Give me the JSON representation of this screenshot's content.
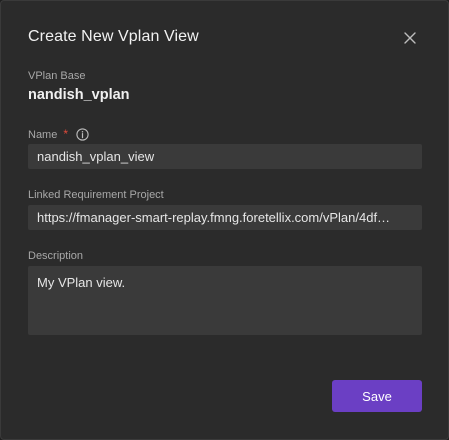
{
  "dialog": {
    "title": "Create New Vplan View",
    "close_icon": "close-icon"
  },
  "vplan_base": {
    "label": "VPlan Base",
    "value": "nandish_vplan"
  },
  "name": {
    "label": "Name",
    "required_marker": "*",
    "info_icon": "info-icon",
    "value": "nandish_vplan_view"
  },
  "linked_project": {
    "label": "Linked Requirement Project",
    "value": "https://fmanager-smart-replay.fmng.foretellix.com/vPlan/4df…"
  },
  "description": {
    "label": "Description",
    "value": "My VPlan view."
  },
  "actions": {
    "save_label": "Save"
  },
  "colors": {
    "dialog_bg": "#2b2b2b",
    "input_bg": "#3a3a3a",
    "accent": "#6b3fc4",
    "required": "#e04a3b"
  }
}
